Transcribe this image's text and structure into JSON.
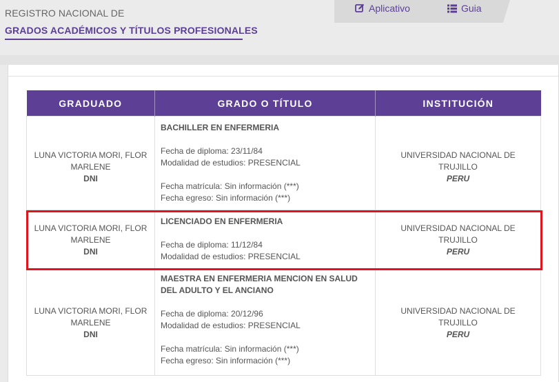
{
  "header": {
    "line1": "REGISTRO NACIONAL DE",
    "line2": "GRADOS ACADÉMICOS Y TÍTULOS PROFESIONALES"
  },
  "nav": {
    "aplicativo": "Aplicativo",
    "guia": "Guia"
  },
  "table": {
    "headers": [
      "GRADUADO",
      "GRADO O TÍTULO",
      "INSTITUCIÓN"
    ],
    "rows": [
      {
        "graduado": {
          "nombre": "LUNA VICTORIA MORI, FLOR MARLENE",
          "doc": "DNI"
        },
        "grado": {
          "titulo": "BACHILLER EN ENFERMERIA",
          "fecha_diploma": "Fecha de diploma: 23/11/84",
          "modalidad": "Modalidad de estudios: PRESENCIAL",
          "fecha_matricula": "Fecha matrícula: Sin información (***)",
          "fecha_egreso": "Fecha egreso: Sin información (***)"
        },
        "institucion": {
          "nombre": "UNIVERSIDAD NACIONAL DE TRUJILLO",
          "pais": "PERU"
        }
      },
      {
        "graduado": {
          "nombre": "LUNA VICTORIA MORI, FLOR MARLENE",
          "doc": "DNI"
        },
        "grado": {
          "titulo": "LICENCIADO EN ENFERMERIA",
          "fecha_diploma": "Fecha de diploma: 11/12/84",
          "modalidad": "Modalidad de estudios: PRESENCIAL"
        },
        "institucion": {
          "nombre": "UNIVERSIDAD NACIONAL DE TRUJILLO",
          "pais": "PERU"
        }
      },
      {
        "graduado": {
          "nombre": "LUNA VICTORIA MORI, FLOR MARLENE",
          "doc": "DNI"
        },
        "grado": {
          "titulo": "MAESTRA EN ENFERMERIA MENCION EN SALUD DEL ADULTO Y EL ANCIANO",
          "fecha_diploma": "Fecha de diploma: 20/12/96",
          "modalidad": "Modalidad de estudios: PRESENCIAL",
          "fecha_matricula": "Fecha matrícula: Sin información (***)",
          "fecha_egreso": "Fecha egreso: Sin información (***)"
        },
        "institucion": {
          "nombre": "UNIVERSIDAD NACIONAL DE TRUJILLO",
          "pais": "PERU"
        }
      }
    ]
  },
  "colors": {
    "brand_purple": "#5e3f96",
    "highlight_red": "#e0141c"
  },
  "icons": [
    "edit-icon",
    "list-icon"
  ]
}
